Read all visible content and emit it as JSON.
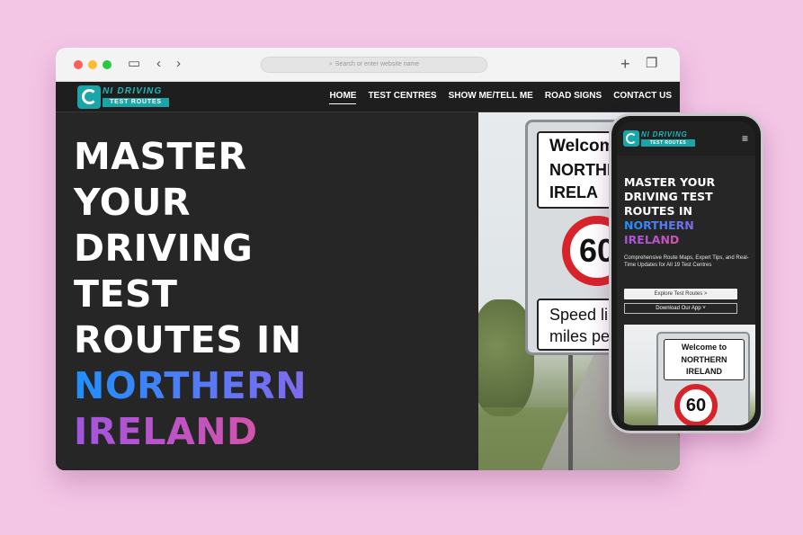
{
  "browser": {
    "address_placeholder": "Search or enter website name",
    "icons": [
      "sidebar-icon",
      "back-chevron-icon",
      "forward-chevron-icon",
      "plus-icon",
      "tabs-icon"
    ]
  },
  "site": {
    "logo_title": "NI DRIVING",
    "logo_sub": "TEST ROUTES",
    "nav": [
      "HOME",
      "TEST CENTRES",
      "SHOW ME/TELL ME",
      "ROAD SIGNS",
      "CONTACT US"
    ],
    "hero": {
      "line1": "MASTER",
      "line2": "YOUR",
      "line3": "DRIVING",
      "line4": "TEST",
      "line5": "ROUTES IN",
      "line6": "NORTHERN",
      "line7": "IRELAND"
    },
    "sign": {
      "line1": "Welcome",
      "line2": "NORTHERN",
      "line3": "IRELA",
      "speed": "60",
      "line4": "Speed lin",
      "line5": "miles per"
    }
  },
  "phone": {
    "logo_title": "NI DRIVING",
    "logo_sub": "TEST ROUTES",
    "title_line1": "MASTER YOUR",
    "title_line2": "DRIVING TEST",
    "title_line3": "ROUTES IN",
    "title_line4": "NORTHERN",
    "title_line5": "IRELAND",
    "description": "Comprehensive Route Maps, Expert Tips, and Real-Time Updates for All 19 Test Centres",
    "button_explore": "Explore Test Routes >",
    "button_download": "Download Our App ˅",
    "sign": {
      "line1": "Welcome to",
      "line2": "NORTHERN",
      "line3": "IRELAND",
      "speed": "60"
    }
  },
  "colors": {
    "background": "#f4c6e6",
    "teal_accent": "#1aa5a8",
    "gradient_blue": "#1e90ff",
    "gradient_pink": "#f2547a"
  }
}
